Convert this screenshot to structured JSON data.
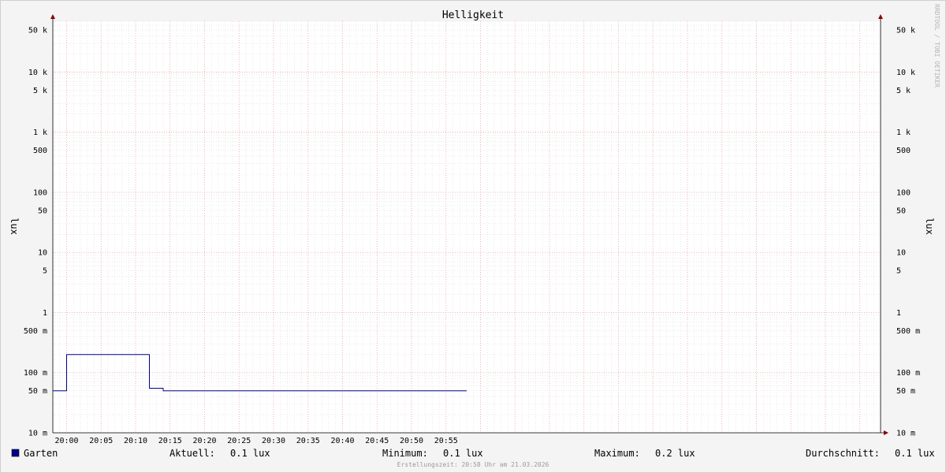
{
  "chart_data": {
    "type": "line",
    "title": "Helligkeit",
    "ylabel": "lux",
    "ylabel_right": "lux",
    "yscale": "log",
    "ylim": [
      0.01,
      70000
    ],
    "y_ticks": [
      {
        "value": 50000,
        "label": "50 k"
      },
      {
        "value": 10000,
        "label": "10 k"
      },
      {
        "value": 5000,
        "label": "5 k"
      },
      {
        "value": 1000,
        "label": "1 k"
      },
      {
        "value": 500,
        "label": "500"
      },
      {
        "value": 100,
        "label": "100"
      },
      {
        "value": 50,
        "label": "50"
      },
      {
        "value": 10,
        "label": "10"
      },
      {
        "value": 5,
        "label": "5"
      },
      {
        "value": 1,
        "label": "1"
      },
      {
        "value": 0.5,
        "label": "500 m"
      },
      {
        "value": 0.1,
        "label": "100 m"
      },
      {
        "value": 0.05,
        "label": "50 m"
      },
      {
        "value": 0.01,
        "label": "10 m"
      }
    ],
    "xlim": [
      "19:58",
      "21:58"
    ],
    "x_ticks": [
      "20:00",
      "20:05",
      "20:10",
      "20:15",
      "20:20",
      "20:25",
      "20:30",
      "20:35",
      "20:40",
      "20:45",
      "20:50",
      "20:55"
    ],
    "series": [
      {
        "name": "Garten",
        "color": "#00008b",
        "points": [
          [
            "19:58",
            0.05
          ],
          [
            "20:00",
            0.05
          ],
          [
            "20:00",
            0.2
          ],
          [
            "20:12",
            0.2
          ],
          [
            "20:12",
            0.055
          ],
          [
            "20:14",
            0.055
          ],
          [
            "20:14",
            0.05
          ],
          [
            "20:58",
            0.05
          ]
        ]
      }
    ],
    "grid": true,
    "watermark": "RRDTOOL / TOBI OETIKER"
  },
  "legend": {
    "series_name": "Garten",
    "series_color": "#00008b",
    "current_label": "Aktuell:",
    "current_value": "0.1 lux",
    "min_label": "Minimum:",
    "min_value": "0.1 lux",
    "max_label": "Maximum:",
    "max_value": "0.2 lux",
    "avg_label": "Durchschnitt:",
    "avg_value": "0.1 lux"
  },
  "footer": "Erstellungszeit: 20:58 Uhr am 21.03.2026"
}
